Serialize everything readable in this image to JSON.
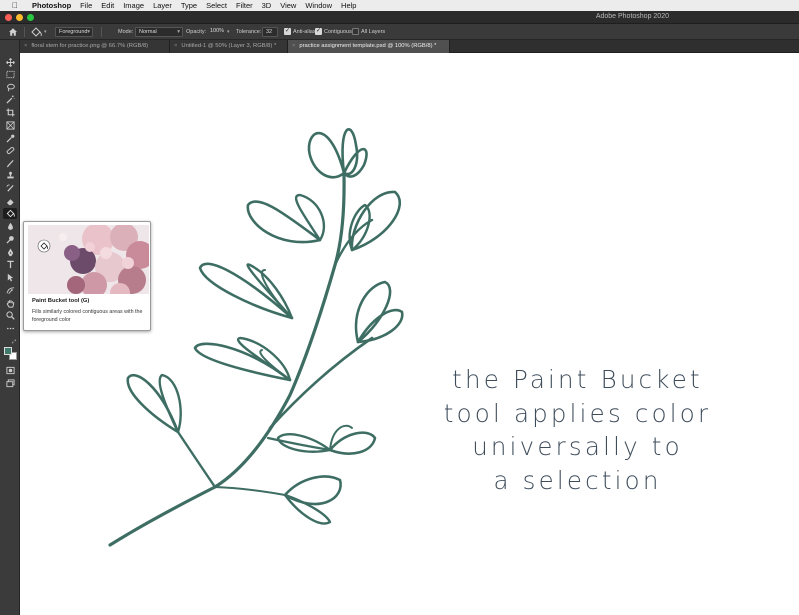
{
  "menubar": {
    "apple_glyph": "",
    "items": [
      "Photoshop",
      "File",
      "Edit",
      "Image",
      "Layer",
      "Type",
      "Select",
      "Filter",
      "3D",
      "View",
      "Window",
      "Help"
    ]
  },
  "titlebar": {
    "title": "Adobe Photoshop 2020",
    "traffic_colors": [
      "#ff5f57",
      "#febc2e",
      "#28c840"
    ]
  },
  "options": {
    "fill_source": "Foreground",
    "mode_label": "Mode:",
    "mode_value": "Normal",
    "opacity_label": "Opacity:",
    "opacity_value": "100%",
    "tolerance_label": "Tolerance:",
    "tolerance_value": "32",
    "anti_alias_label": "Anti-alias",
    "anti_alias_checked": true,
    "contiguous_label": "Contiguous",
    "contiguous_checked": true,
    "all_layers_label": "All Layers",
    "all_layers_checked": false
  },
  "tabs": [
    {
      "close": "×",
      "label": "floral stem for practice.png @ 66.7% (RGB/8)",
      "active": false
    },
    {
      "close": "×",
      "label": "Untitled-1 @ 50% (Layer 3, RGB/8) *",
      "active": false
    },
    {
      "close": "×",
      "label": "practice assignment template.psd @ 100% (RGB/8) *",
      "active": true
    }
  ],
  "tools": [
    "move-tool-icon",
    "marquee-tool-icon",
    "lasso-tool-icon",
    "magic-wand-icon",
    "crop-tool-icon",
    "frame-tool-icon",
    "eyedropper-icon",
    "healing-brush-icon",
    "brush-tool-icon",
    "clone-stamp-icon",
    "history-brush-icon",
    "eraser-icon",
    "paint-bucket-icon",
    "blur-tool-icon",
    "dodge-tool-icon",
    "pen-tool-icon",
    "type-tool-icon",
    "path-selection-icon",
    "shape-tool-icon",
    "hand-tool-icon",
    "zoom-tool-icon",
    "more-tools-icon",
    "color-swatches",
    "quick-mask-icon",
    "screen-mode-icon"
  ],
  "colors": {
    "foreground": "#3f7a6c",
    "background": "#ffffff",
    "stroke": "#3e6e63",
    "caption": "#3f4d5b"
  },
  "tooltip": {
    "title": "Paint Bucket tool (G)",
    "description": "Fills similarly colored contiguous areas with the foreground color"
  },
  "caption": {
    "lines": [
      "the Paint Bucket",
      "tool applies color",
      "universally to",
      "a selection"
    ]
  }
}
